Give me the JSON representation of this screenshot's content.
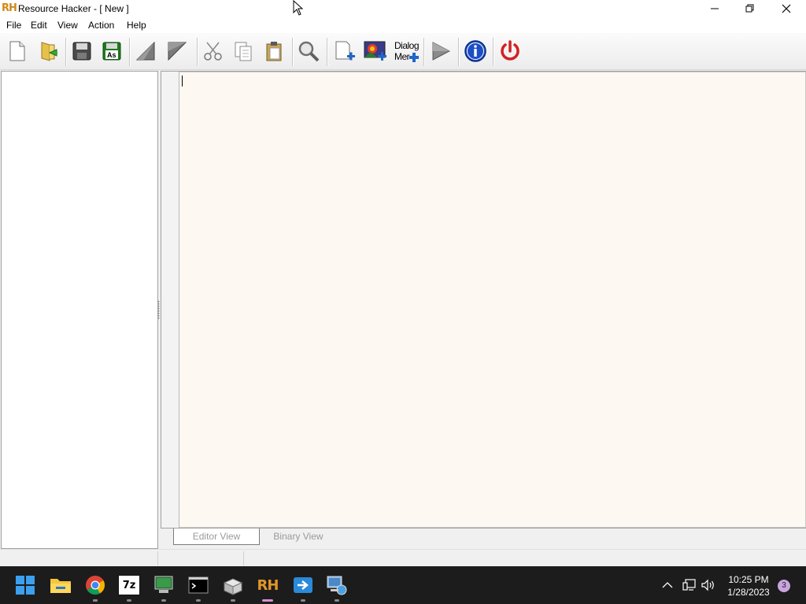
{
  "window": {
    "app_icon_text": "RH",
    "title": "Resource Hacker - [ New ]"
  },
  "menu": [
    {
      "label": "File"
    },
    {
      "label": "Edit"
    },
    {
      "label": "View"
    },
    {
      "label": "Action"
    },
    {
      "label": "Help"
    }
  ],
  "toolbar": {
    "save_as_badge": "As",
    "dialog_line1": "Dialog",
    "dialog_line2": "Mer"
  },
  "tabs": [
    {
      "label": "Editor View",
      "active": true
    },
    {
      "label": "Binary View",
      "active": false
    }
  ],
  "taskbar": {
    "sevenzip_label": "7z",
    "rh_label": "RH",
    "time": "10:25 PM",
    "date": "1/28/2023",
    "notification_count": "3"
  },
  "colors": {
    "editor_bg": "#fdf8f2",
    "taskbar_bg": "#1c1c1c",
    "rh_orange": "#d08a1a",
    "info_blue": "#1d4fc4",
    "power_red": "#d32020"
  }
}
